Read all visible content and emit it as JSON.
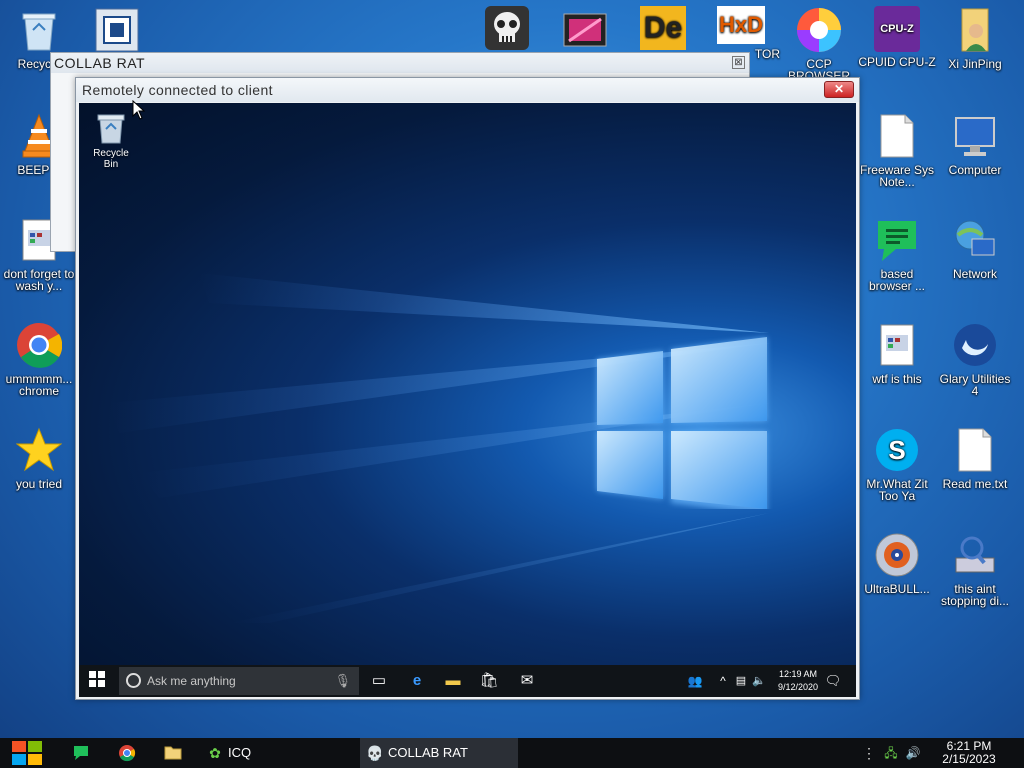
{
  "desktop_icons_left": [
    {
      "label": "Recycle",
      "icon": "recycle-bin-icon"
    },
    {
      "label": "BEEP B",
      "icon": "vlc-icon"
    },
    {
      "label": "dont forget to wash y...",
      "icon": "document-icon"
    },
    {
      "label": "ummmmm... chrome",
      "icon": "chrome-icon"
    },
    {
      "label": "you tried",
      "icon": "star-icon"
    }
  ],
  "desktop_icons_top": [
    {
      "label": "",
      "icon": "virtualbox-icon"
    },
    {
      "label": "",
      "icon": "skull-icon"
    },
    {
      "label": "",
      "icon": "film-icon"
    },
    {
      "label": "",
      "icon": "de-icon"
    },
    {
      "label": "TOR",
      "icon": "hxd-icon"
    },
    {
      "label": "CCP BROWSER",
      "icon": "ccp-browser-icon"
    },
    {
      "label": "CPUID CPU-Z",
      "icon": "cpuz-icon"
    },
    {
      "label": "Xi JinPing",
      "icon": "folder-user-icon"
    }
  ],
  "desktop_icons_right": [
    {
      "label": "Freeware Sys Note...",
      "icon": "text-file-icon"
    },
    {
      "label": "Computer",
      "icon": "computer-icon"
    },
    {
      "label": "based browser ...",
      "icon": "green-doc-icon"
    },
    {
      "label": "Network",
      "icon": "network-icon"
    },
    {
      "label": "wtf is this",
      "icon": "document-icon"
    },
    {
      "label": "Glary Utilities 4",
      "icon": "glary-icon"
    },
    {
      "label": "Mr.What Zit Too Ya",
      "icon": "skype-icon"
    },
    {
      "label": "Read me.txt",
      "icon": "text-file-icon"
    },
    {
      "label": "UltraBULL...",
      "icon": "disc-icon"
    },
    {
      "label": "this aint stopping di...",
      "icon": "scanner-icon"
    }
  ],
  "collab_window": {
    "title": "COLLAB RAT",
    "close": "⊠"
  },
  "remote_window": {
    "title": "Remotely connected to client",
    "close": "✕",
    "recycle_bin_label": "Recycle Bin",
    "search_placeholder": "Ask me anything",
    "clock_time": "12:19 AM",
    "clock_date": "9/12/2020"
  },
  "taskbar": {
    "items": [
      {
        "label": "ICQ",
        "icon": "icq-icon"
      },
      {
        "label": "COLLAB RAT",
        "icon": "collab-rat-icon"
      }
    ],
    "clock_time": "6:21 PM",
    "clock_date": "2/15/2023"
  }
}
